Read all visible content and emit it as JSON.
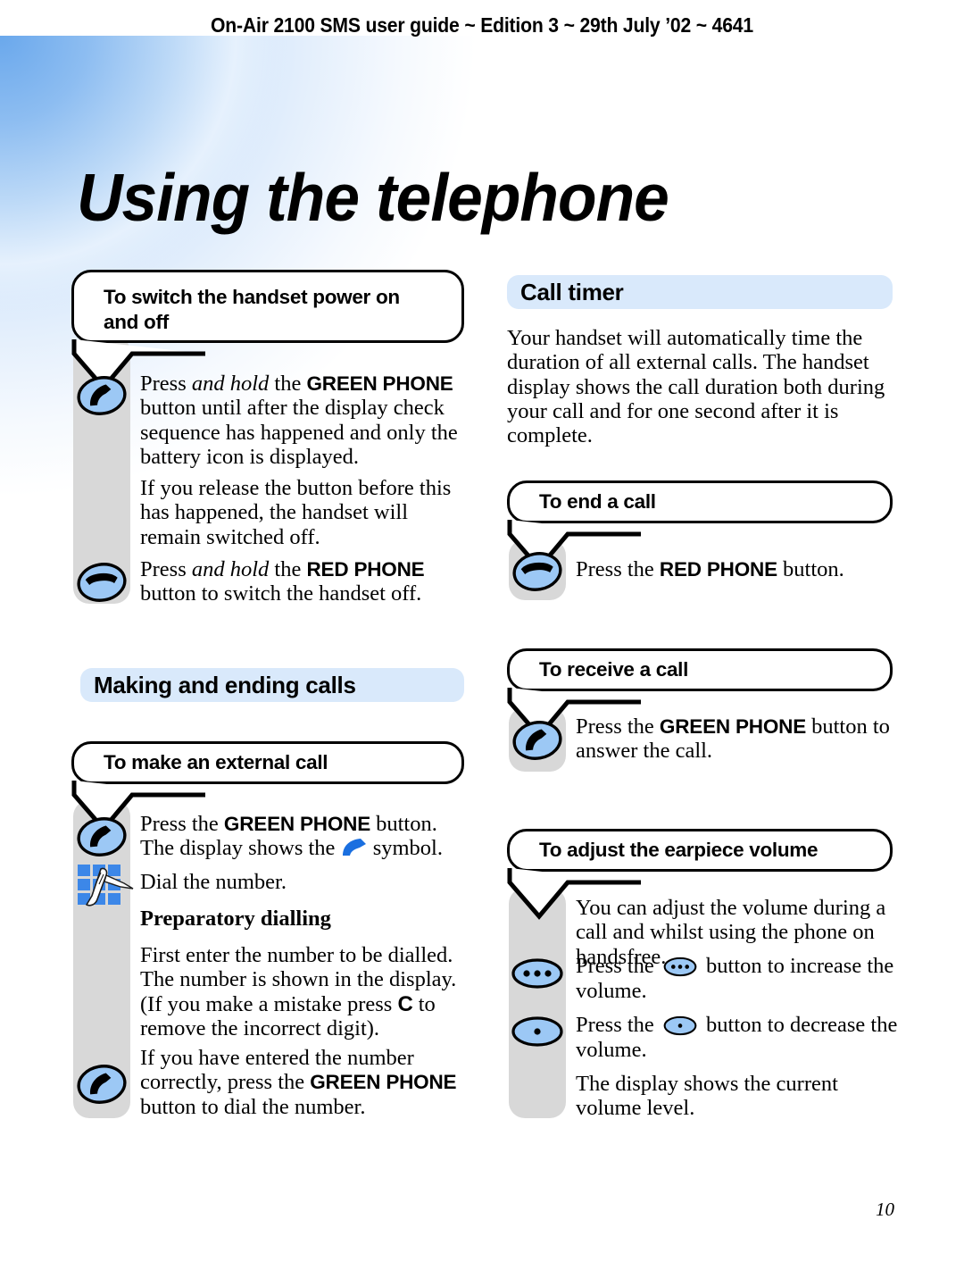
{
  "running_head": "On-Air 2100 SMS user guide ~ Edition 3 ~ 29th July ’02 ~ 4641",
  "page_title": "Using the telephone",
  "page_number": "10",
  "colors": {
    "section_bar": "#d9e9fb",
    "icon_fill": "#9cc8f5",
    "strip_gray": "#d8d8d8",
    "keypad_blue": "#3c87e8",
    "inline_phone_blue": "#1a6fe0"
  },
  "left_column": {
    "callout_power": {
      "line1": "To switch the handset power on",
      "line2": "and off"
    },
    "para_power_on": {
      "p1_a": "Press ",
      "p1_i": "and hold",
      "p1_b": " the ",
      "p1_bold": "GREEN PHONE",
      "p1_c": " button until after the display check sequence has happened and only the battery icon is displayed."
    },
    "para_release": "If you release the button before this has happened, the handset will remain switched off.",
    "para_power_off": {
      "a": "Press ",
      "i": "and hold",
      "b": " the ",
      "bold": "RED PHONE",
      "c": " button to switch the handset off."
    },
    "section_making": "Making and ending calls",
    "callout_external": "To make an external call",
    "para_external_1a": "Press the ",
    "para_external_1b": "GREEN PHONE",
    "para_external_1c": " button.",
    "para_external_2a": "The display shows the ",
    "para_external_2b": " symbol.",
    "para_dial": "Dial the number.",
    "sub_prep": "Preparatory dialling",
    "para_prep": {
      "a": "First enter the number to be dialled. The number is shown in the display. (If you make a mistake press ",
      "bold": "C",
      "b": " to remove the incorrect digit)."
    },
    "para_confirm": {
      "a": "If you have entered the number correctly, press the ",
      "bold": "GREEN PHONE",
      "b": " button to dial the number."
    }
  },
  "right_column": {
    "section_call_timer": "Call timer",
    "para_call_timer": "Your handset will automatically time the duration of all external calls. The handset display shows the call duration both during your call and for one second after it is complete.",
    "callout_end_call": "To end a call",
    "para_end_call": {
      "a": "Press the ",
      "bold": "RED PHONE",
      "b": " button."
    },
    "callout_receive_call": "To receive a call",
    "para_receive_call": {
      "a": "Press the ",
      "bold": "GREEN PHONE",
      "b": " button to answer the call."
    },
    "callout_earpiece_volume": "To adjust the earpiece volume",
    "para_volume_intro": "You can adjust the volume during a call and whilst using the phone on handsfree.",
    "para_vol_up_a": "Press the ",
    "para_vol_up_b": " button to increase the volume.",
    "para_vol_down_a": "Press the ",
    "para_vol_down_b": " button to decrease the volume.",
    "para_vol_level": "The display shows the current volume level."
  },
  "icons": {
    "green_phone": "green-phone-icon",
    "red_phone": "red-phone-icon",
    "keypad": "keypad-hand-icon",
    "volume_up": "volume-up-icon",
    "volume_down": "volume-down-icon"
  }
}
